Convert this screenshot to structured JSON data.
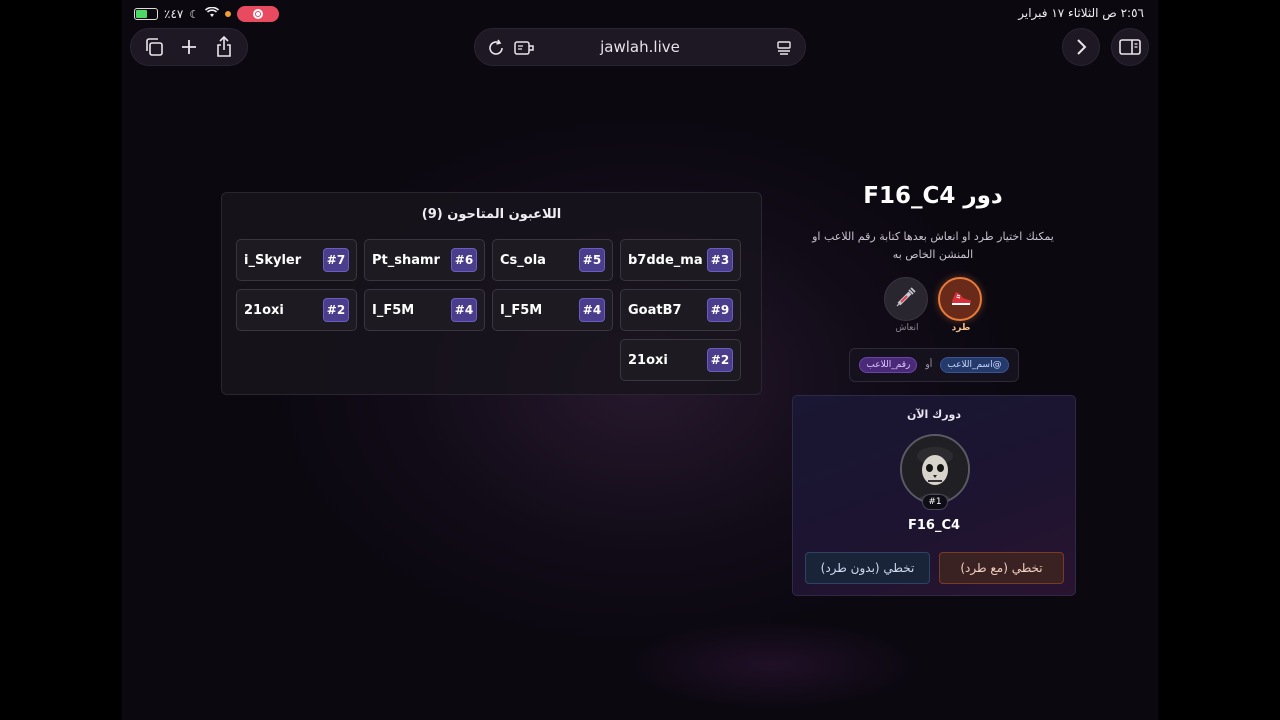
{
  "status_bar": {
    "time_date": "٢:٥٦ ص  الثلاثاء ١٧ فبراير",
    "battery": "٪٤٧"
  },
  "browser": {
    "url": "jawlah.live"
  },
  "players_panel": {
    "title": "اللاعبون المتاحون (9)",
    "players": [
      {
        "name": "b7dde_ma",
        "number": "#3"
      },
      {
        "name": "Cs_ola",
        "number": "#5"
      },
      {
        "name": "Pt_shamr",
        "number": "#6"
      },
      {
        "name": "i_Skyler",
        "number": "#7"
      },
      {
        "name": "GoatB7",
        "number": "#9"
      },
      {
        "name": "I_F5M",
        "number": "#4"
      },
      {
        "name": "I_F5M",
        "number": "#4"
      },
      {
        "name": "21oxi",
        "number": "#2"
      },
      {
        "name": "21oxi",
        "number": "#2"
      }
    ]
  },
  "turn": {
    "title": "دور F16_C4",
    "hint": "يمكنك اختيار طرد او انعاش بعدها كتابة رقم اللاعب او المنشن الخاص به",
    "actions": {
      "kick_label": "طرد",
      "revive_label": "انعاش"
    },
    "syntax": {
      "mention_chip": "@اسم_اللاعب",
      "or": "أو",
      "number_chip": "رقم_اللاعب"
    }
  },
  "current_turn_card": {
    "title": "دورك الآن",
    "rank": "#1",
    "player_name": "F16_C4",
    "skip_with_kick": "تخطي (مع طرد)",
    "skip_without_kick": "تخطي (بدون طرد)"
  },
  "icons": [
    "tabs-icon",
    "plus-icon",
    "share-icon",
    "reload-icon",
    "reader-icon",
    "tab-menu-icon",
    "forward-icon",
    "sidebar-icon",
    "boot-icon",
    "syringe-icon",
    "skull-avatar"
  ],
  "colors": {
    "accent_purple": "#4a3d8c",
    "kick_orange": "#e87a3a",
    "background": "#0b0810"
  }
}
